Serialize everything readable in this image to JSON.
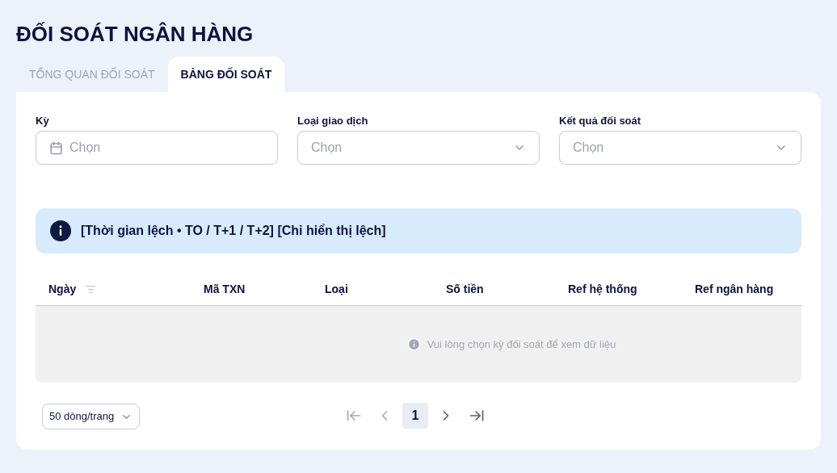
{
  "title": "ĐỐI SOÁT NGÂN HÀNG",
  "tabs": [
    {
      "label": "TỔNG QUAN ĐỐI SOÁT",
      "selected": false
    },
    {
      "label": "BẢNG ĐỐI SOÁT",
      "selected": true
    }
  ],
  "filters": [
    {
      "kind": "date",
      "label": "Kỳ",
      "placeholder": "Chọn"
    },
    {
      "kind": "select",
      "label": "Loại giao dịch",
      "placeholder": "Chọn"
    },
    {
      "kind": "select",
      "label": "Kết quả đối soát",
      "placeholder": "Chọn"
    }
  ],
  "banner": "[Thời gian lệch • TO / T+1 / T+2] [Chỉ hiển thị lệch]",
  "table": {
    "columns": [
      {
        "label": "Ngày",
        "filter": true
      },
      {
        "label": "Mã TXN",
        "filter": false
      },
      {
        "label": "Loại",
        "filter": false
      },
      {
        "label": "Số tiền",
        "filter": false
      },
      {
        "label": "Ref hệ thống",
        "filter": false
      },
      {
        "label": "Ref ngân hàng",
        "filter": false
      }
    ],
    "empty_message": "Vui lòng chọn kỳ đối soát để xem dữ liệu"
  },
  "pagination": {
    "page_size": "50 dòng/trang",
    "pages": [
      {
        "label": "1",
        "selected": true
      }
    ],
    "first_disabled": true,
    "prev_disabled": true,
    "next_disabled": false,
    "last_disabled": false
  }
}
